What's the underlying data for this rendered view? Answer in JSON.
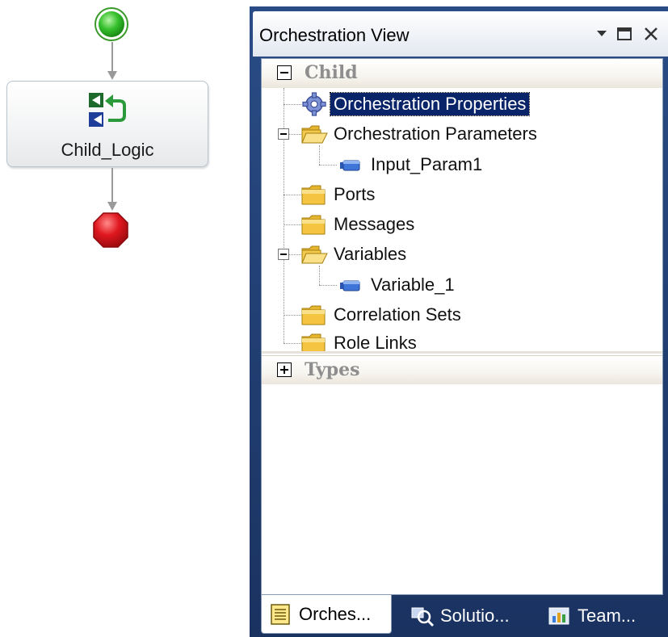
{
  "canvas": {
    "shape": {
      "label": "Child_Logic",
      "icon": "call-orchestration-icon"
    },
    "start_icon": "start-shape-icon",
    "end_icon": "stop-shape-icon"
  },
  "panel": {
    "title": "Orchestration View",
    "controls": [
      "window-position-dropdown-icon",
      "maximize-icon",
      "close-icon"
    ],
    "sections": {
      "child": {
        "title": "Child",
        "expanded": true
      },
      "types": {
        "title": "Types",
        "expanded": false
      }
    },
    "tree": [
      {
        "label": "Orchestration Properties",
        "icon": "gear-icon",
        "selected": true
      },
      {
        "label": "Orchestration Parameters",
        "icon": "open-folder-icon",
        "expanded": true
      },
      {
        "label": "Input_Param1",
        "icon": "parameter-icon"
      },
      {
        "label": "Ports",
        "icon": "folder-icon"
      },
      {
        "label": "Messages",
        "icon": "folder-icon"
      },
      {
        "label": "Variables",
        "icon": "open-folder-icon",
        "expanded": true
      },
      {
        "label": "Variable_1",
        "icon": "variable-icon"
      },
      {
        "label": "Correlation Sets",
        "icon": "folder-icon"
      },
      {
        "label": "Role Links",
        "icon": "folder-icon"
      }
    ],
    "tabs": [
      {
        "label": "Orches...",
        "icon": "orchestration-view-icon",
        "active": true
      },
      {
        "label": "Solutio...",
        "icon": "solution-explorer-icon",
        "active": false
      },
      {
        "label": "Team...",
        "icon": "team-explorer-icon",
        "active": false
      }
    ],
    "colors": {
      "frame": "#1d3a6b",
      "selection": "#0a246a",
      "folder": "#f5c542",
      "start": "#1ea01e",
      "stop": "#d8141c"
    }
  }
}
